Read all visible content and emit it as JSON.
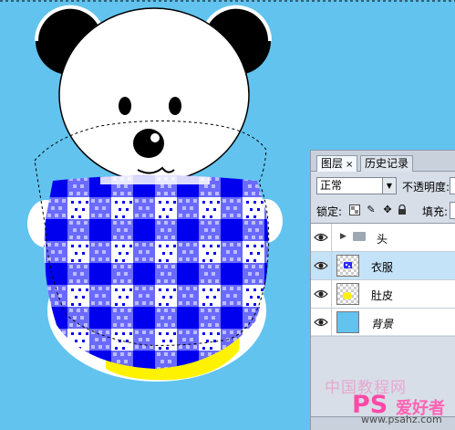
{
  "layers_panel": {
    "tabs": [
      {
        "label": "图层",
        "close": "×"
      },
      {
        "label": "历史记录"
      }
    ],
    "blend_mode": "正常",
    "opacity_label": "不透明度:",
    "lock_label": "锁定:",
    "fill_label": "填充:",
    "layers": [
      {
        "name": "头",
        "type": "group"
      },
      {
        "name": "衣服",
        "type": "layer",
        "selected": true
      },
      {
        "name": "肚皮",
        "type": "layer"
      },
      {
        "name": "背景",
        "type": "background"
      }
    ]
  },
  "watermark": {
    "line1": "中国教程网",
    "ps_logo": "PS",
    "site_name": "爱好者",
    "url": "www.psahz.com"
  },
  "colors": {
    "background": "#62c3ee",
    "shirt_blue": "#0000ee",
    "belly_yellow": "#fff200",
    "selected_layer": "#c5e3f8"
  }
}
